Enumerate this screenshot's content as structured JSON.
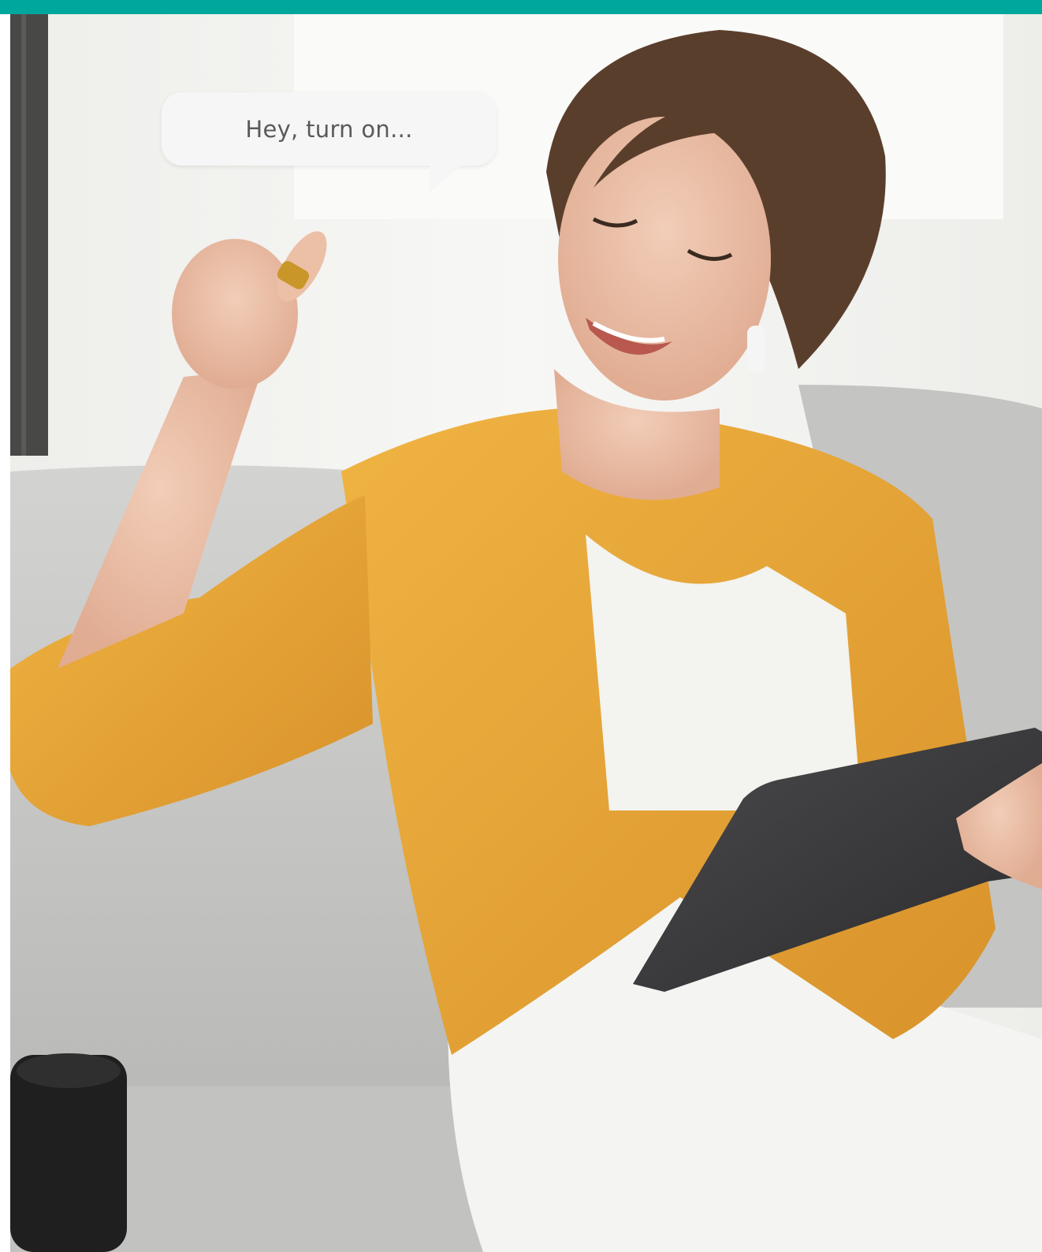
{
  "speech_bubble": {
    "text": "Hey, turn on..."
  },
  "colors": {
    "accent_bar": "#00a79d",
    "shirt": "#e8a535",
    "sofa": "#c9c9c7",
    "top": "#f2f2ef",
    "tablet": "#3b3b3d"
  },
  "photo": {
    "subject": "woman-on-sofa-photo"
  }
}
